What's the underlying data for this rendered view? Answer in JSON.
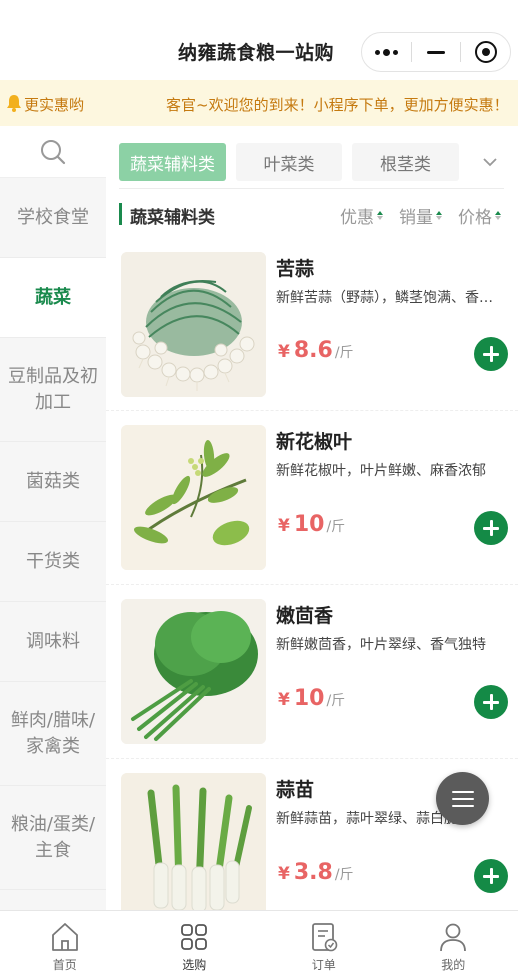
{
  "header": {
    "title": "纳雍蔬食粮一站购"
  },
  "notice": {
    "label": "更实惠哟",
    "text": "客官~欢迎您的到来！小程序下单，更加方便实惠！"
  },
  "sidebar": {
    "search_icon": "search-icon",
    "categories": [
      {
        "label": "学校食堂"
      },
      {
        "label": "蔬菜"
      },
      {
        "label": "豆制品及初加工"
      },
      {
        "label": "菌菇类"
      },
      {
        "label": "干货类"
      },
      {
        "label": "调味料"
      },
      {
        "label": "鲜肉/腊味/家禽类"
      },
      {
        "label": "粮油/蛋类/主食"
      }
    ],
    "active_category": "蔬菜"
  },
  "subtabs": [
    {
      "label": "蔬菜辅料类"
    },
    {
      "label": "叶菜类"
    },
    {
      "label": "根茎类"
    }
  ],
  "section": {
    "title": "蔬菜辅料类",
    "sorts": [
      {
        "label": "优惠"
      },
      {
        "label": "销量"
      },
      {
        "label": "价格"
      }
    ]
  },
  "products": [
    {
      "name": "苦蒜",
      "desc": "新鲜苦蒜（野蒜），鳞茎饱满、香气浓郁",
      "currency": "¥",
      "price": "8.6",
      "unit": "/斤"
    },
    {
      "name": "新花椒叶",
      "desc": "新鲜花椒叶，叶片鲜嫩、麻香浓郁",
      "currency": "¥",
      "price": "10",
      "unit": "/斤"
    },
    {
      "name": "嫩茴香",
      "desc": "新鲜嫩茴香，叶片翠绿、香气独特",
      "currency": "¥",
      "price": "10",
      "unit": "/斤"
    },
    {
      "name": "蒜苗",
      "desc": "新鲜蒜苗，蒜叶翠绿、蒜白脆嫩",
      "currency": "¥",
      "price": "3.8",
      "unit": "/斤"
    }
  ],
  "tabbar": [
    {
      "label": "首页",
      "icon": "home-icon"
    },
    {
      "label": "选购",
      "icon": "category-grid-icon"
    },
    {
      "label": "订单",
      "icon": "order-icon"
    },
    {
      "label": "我的",
      "icon": "user-icon"
    }
  ],
  "colors": {
    "brand_green": "#1a8a4d",
    "tab_active": "#8cd1a5",
    "price_red": "#e86464",
    "notice_bg": "#fdf7df",
    "notice_text": "#c57a10"
  }
}
